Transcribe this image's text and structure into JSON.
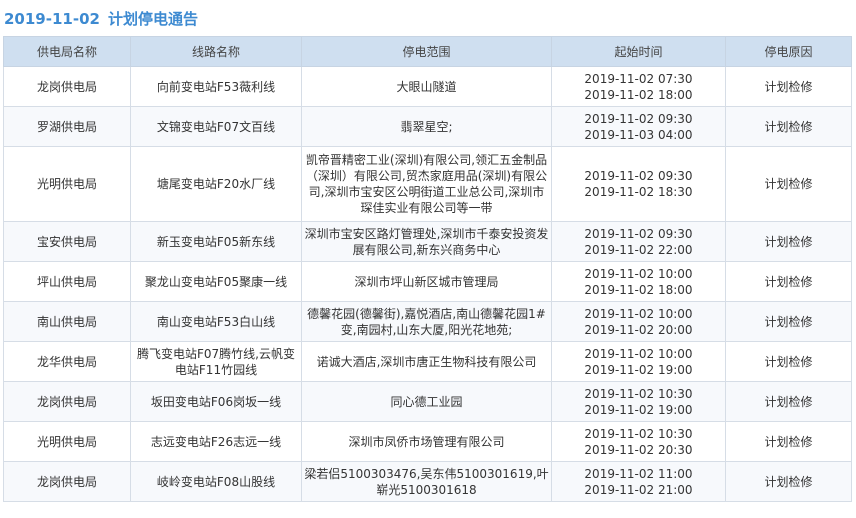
{
  "notice": {
    "date": "2019-11-02",
    "title": "计划停电通告"
  },
  "table": {
    "headers": [
      "供电局名称",
      "线路名称",
      "停电范围",
      "起始时间",
      "停电原因"
    ],
    "rows": [
      {
        "bureau": "龙岗供电局",
        "line": "向前变电站F53薇利线",
        "range": "大眼山隧道",
        "start": "2019-11-02 07:30",
        "end": "2019-11-02 18:00",
        "reason": "计划检修"
      },
      {
        "bureau": "罗湖供电局",
        "line": "文锦变电站F07文百线",
        "range": "翡翠星空;",
        "start": "2019-11-02 09:30",
        "end": "2019-11-03 04:00",
        "reason": "计划检修"
      },
      {
        "bureau": "光明供电局",
        "line": "塘尾变电站F20水厂线",
        "range": "凯帝晋精密工业(深圳)有限公司,领汇五金制品（深圳）有限公司,贸杰家庭用品(深圳)有限公司,深圳市宝安区公明街道工业总公司,深圳市琛佳实业有限公司等一带",
        "start": "2019-11-02 09:30",
        "end": "2019-11-02 18:30",
        "reason": "计划检修"
      },
      {
        "bureau": "宝安供电局",
        "line": "新玉变电站F05新东线",
        "range": "深圳市宝安区路灯管理处,深圳市千泰安投资发展有限公司,新东兴商务中心",
        "start": "2019-11-02 09:30",
        "end": "2019-11-02 22:00",
        "reason": "计划检修"
      },
      {
        "bureau": "坪山供电局",
        "line": "聚龙山变电站F05聚康一线",
        "range": "深圳市坪山新区城市管理局",
        "start": "2019-11-02 10:00",
        "end": "2019-11-02 18:00",
        "reason": "计划检修"
      },
      {
        "bureau": "南山供电局",
        "line": "南山变电站F53白山线",
        "range": "德馨花园(德馨街),嘉悦酒店,南山德馨花园1#变,南园村,山东大厦,阳光花地苑;",
        "start": "2019-11-02 10:00",
        "end": "2019-11-02 20:00",
        "reason": "计划检修"
      },
      {
        "bureau": "龙华供电局",
        "line": "腾飞变电站F07腾竹线,云帆变电站F11竹园线",
        "range": "诺诚大酒店,深圳市唐正生物科技有限公司",
        "start": "2019-11-02 10:00",
        "end": "2019-11-02 19:00",
        "reason": "计划检修"
      },
      {
        "bureau": "龙岗供电局",
        "line": "坂田变电站F06岗坂一线",
        "range": "同心德工业园",
        "start": "2019-11-02 10:30",
        "end": "2019-11-02 19:00",
        "reason": "计划检修"
      },
      {
        "bureau": "光明供电局",
        "line": "志远变电站F26志远一线",
        "range": "深圳市凤侨市场管理有限公司",
        "start": "2019-11-02 10:30",
        "end": "2019-11-02 20:30",
        "reason": "计划检修"
      },
      {
        "bureau": "龙岗供电局",
        "line": "岐岭变电站F08山股线",
        "range": "梁若侣5100303476,吴东伟5100301619,叶崭光5100301618",
        "start": "2019-11-02 11:00",
        "end": "2019-11-02 21:00",
        "reason": "计划检修"
      }
    ]
  }
}
